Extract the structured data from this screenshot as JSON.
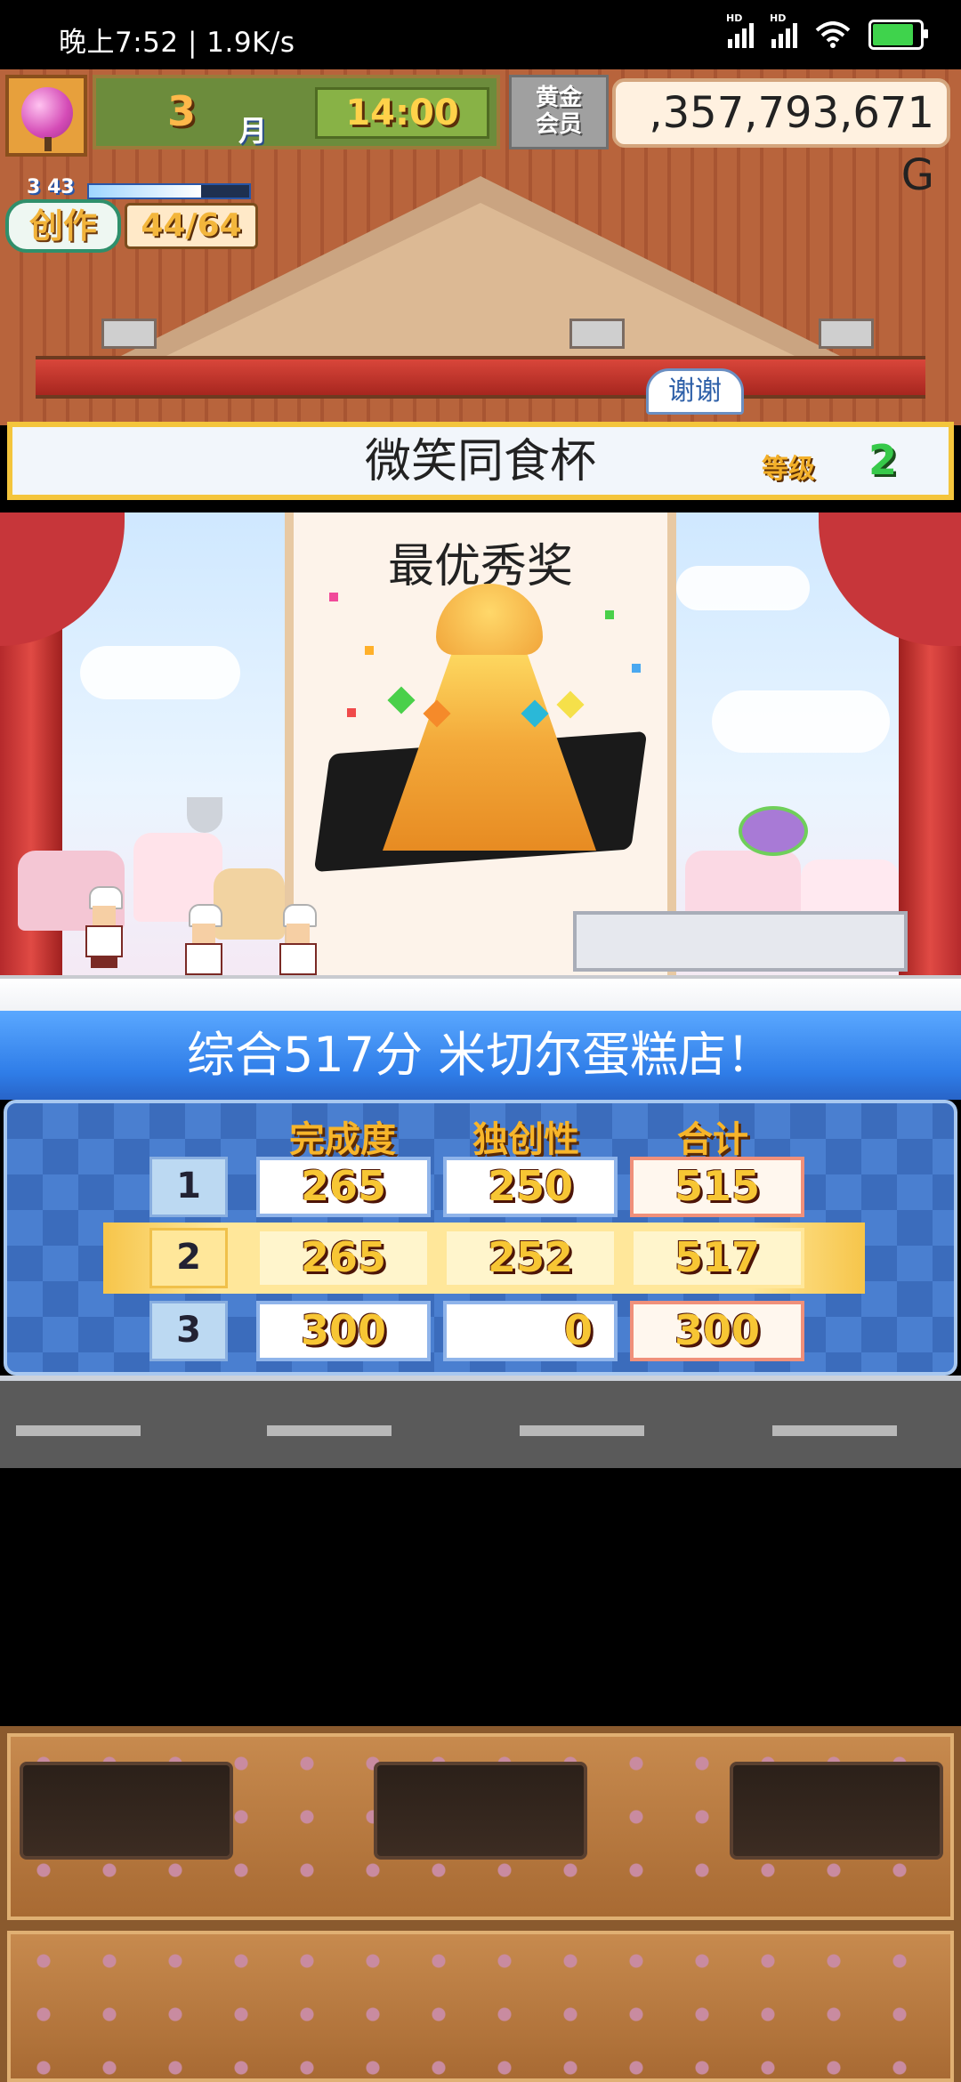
{
  "status_bar": {
    "time": "晚上7:52 | 1.9K/s",
    "signal1_label": "HD",
    "signal2_label": "HD"
  },
  "hud": {
    "month": "3",
    "month_unit": "月",
    "clock": "14:00",
    "member_line1": "黄金",
    "member_line2": "会员",
    "money": ",357,793,671 G",
    "creation_level": "3 43",
    "creation_label": "创作",
    "creation_value": "44/64"
  },
  "stage": {
    "thanks_label": "谢谢",
    "trophy_name": "微笑同食杯",
    "level_label": "等级",
    "level_value": "2",
    "award_title": "最优秀奖"
  },
  "result": {
    "text": "综合517分 米切尔蛋糕店！"
  },
  "scoreboard": {
    "headers": [
      "完成度",
      "独创性",
      "合计"
    ],
    "rows": [
      {
        "rank": "1",
        "completion": "265",
        "originality": "250",
        "total": "515"
      },
      {
        "rank": "2",
        "completion": "265",
        "originality": "252",
        "total": "517"
      },
      {
        "rank": "3",
        "completion": "300",
        "originality": "0",
        "total": "300"
      }
    ],
    "highlighted_rank": "2"
  },
  "colors": {
    "result_banner": "#2f7de8",
    "score_digits": "#f7c634",
    "highlight_row": "#ffe79a",
    "trophy_border": "#f4c53c"
  }
}
